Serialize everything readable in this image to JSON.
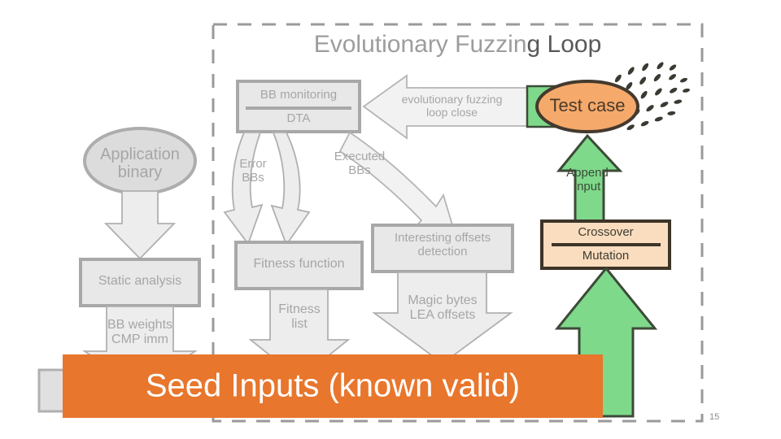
{
  "slide": {
    "page_number": "15",
    "banner_label": "Seed Inputs (known valid)",
    "banner_color": "#e8762c"
  },
  "loop_region": {
    "title_part1": "Evolutionary Fuzzin",
    "title_part2": "g Loop",
    "title_full": "Evolutionary Fuzzing Loop",
    "border_style": "dashed"
  },
  "left_column": {
    "app_binary": "Application\nbinary",
    "static_analysis": "Static analysis",
    "bb_weights_arrow": "BB weights\nCMP imm"
  },
  "center_column": {
    "bb_monitoring": "BB monitoring",
    "dta": "DTA",
    "error_bbs": "Error\nBBs",
    "executed_bbs": "Executed\nBBs",
    "fitness_function": "Fitness function",
    "fitness_list": "Fitness\nlist",
    "interesting_offsets": "Interesting offsets\ndetection",
    "magic_bytes": "Magic bytes\nLEA offsets",
    "loop_close_arrow": "evolutionary fuzzing\nloop close"
  },
  "right_column": {
    "test_case": "Test case",
    "append_input": "Append\ninput",
    "crossover": "Crossover",
    "mutation": "Mutation"
  },
  "colors": {
    "accent_orange": "#e8762c",
    "test_case_fill": "#f5a96a",
    "green_arrow_fill": "#7ed98a",
    "crossover_fill": "#fadcbe",
    "grey_fill": "#e6e6e6",
    "grey_stroke": "#a6a6a6",
    "dark_stroke": "#3d3d33"
  }
}
